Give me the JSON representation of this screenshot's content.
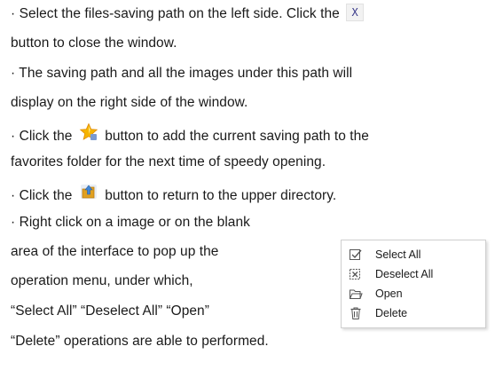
{
  "paragraphs": [
    {
      "bullet": "·",
      "line1_before": " Select the files-saving path on the left side. Click the",
      "close_icon_glyph": "X",
      "line2": "button to close the window."
    },
    {
      "bullet": "·",
      "line1": " The saving path and all the images under this path will",
      "line2": "display on the right side of the window."
    },
    {
      "bullet": "·",
      "line1_before": " Click the",
      "line1_after": "button to add the current saving path to the",
      "line2": "favorites folder for the next time of speedy opening."
    },
    {
      "bullet": "·",
      "line1_before": " Click the",
      "line1_after": "button to return to the upper directory."
    },
    {
      "bullet": "·",
      "line1": " Right click on a image or on the blank",
      "line2": "area of the interface to pop up the",
      "line3": "operation menu, under which,",
      "line4": " “Select  All” “Deselect All” “Open”",
      "line5": "“Delete”  operations are able to performed."
    }
  ],
  "icons": {
    "favorite": "star-icon",
    "upper_directory": "folder-up-icon",
    "close": "close-icon"
  },
  "context_menu": {
    "items": [
      {
        "label": "Select All",
        "icon": "select-all-icon"
      },
      {
        "label": "Deselect All",
        "icon": "deselect-all-icon"
      },
      {
        "label": "Open",
        "icon": "open-icon"
      },
      {
        "label": "Delete",
        "icon": "delete-icon"
      }
    ]
  },
  "colors": {
    "star": "#f5b400",
    "folder": "#e0a020",
    "close_icon_text": "#3a3a8a"
  }
}
